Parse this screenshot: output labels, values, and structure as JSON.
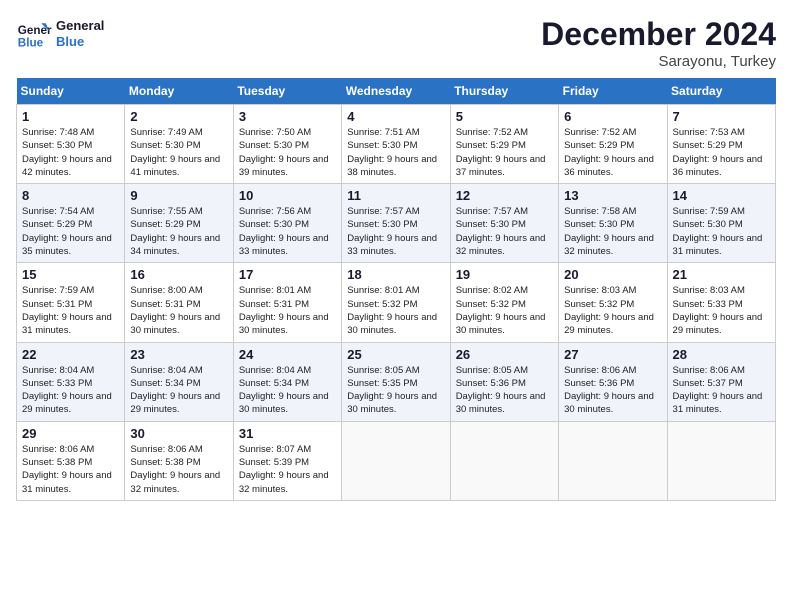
{
  "logo": {
    "line1": "General",
    "line2": "Blue"
  },
  "header": {
    "month": "December 2024",
    "location": "Sarayonu, Turkey"
  },
  "weekdays": [
    "Sunday",
    "Monday",
    "Tuesday",
    "Wednesday",
    "Thursday",
    "Friday",
    "Saturday"
  ],
  "weeks": [
    [
      {
        "day": "1",
        "sunrise": "Sunrise: 7:48 AM",
        "sunset": "Sunset: 5:30 PM",
        "daylight": "Daylight: 9 hours and 42 minutes."
      },
      {
        "day": "2",
        "sunrise": "Sunrise: 7:49 AM",
        "sunset": "Sunset: 5:30 PM",
        "daylight": "Daylight: 9 hours and 41 minutes."
      },
      {
        "day": "3",
        "sunrise": "Sunrise: 7:50 AM",
        "sunset": "Sunset: 5:30 PM",
        "daylight": "Daylight: 9 hours and 39 minutes."
      },
      {
        "day": "4",
        "sunrise": "Sunrise: 7:51 AM",
        "sunset": "Sunset: 5:30 PM",
        "daylight": "Daylight: 9 hours and 38 minutes."
      },
      {
        "day": "5",
        "sunrise": "Sunrise: 7:52 AM",
        "sunset": "Sunset: 5:29 PM",
        "daylight": "Daylight: 9 hours and 37 minutes."
      },
      {
        "day": "6",
        "sunrise": "Sunrise: 7:52 AM",
        "sunset": "Sunset: 5:29 PM",
        "daylight": "Daylight: 9 hours and 36 minutes."
      },
      {
        "day": "7",
        "sunrise": "Sunrise: 7:53 AM",
        "sunset": "Sunset: 5:29 PM",
        "daylight": "Daylight: 9 hours and 36 minutes."
      }
    ],
    [
      {
        "day": "8",
        "sunrise": "Sunrise: 7:54 AM",
        "sunset": "Sunset: 5:29 PM",
        "daylight": "Daylight: 9 hours and 35 minutes."
      },
      {
        "day": "9",
        "sunrise": "Sunrise: 7:55 AM",
        "sunset": "Sunset: 5:29 PM",
        "daylight": "Daylight: 9 hours and 34 minutes."
      },
      {
        "day": "10",
        "sunrise": "Sunrise: 7:56 AM",
        "sunset": "Sunset: 5:30 PM",
        "daylight": "Daylight: 9 hours and 33 minutes."
      },
      {
        "day": "11",
        "sunrise": "Sunrise: 7:57 AM",
        "sunset": "Sunset: 5:30 PM",
        "daylight": "Daylight: 9 hours and 33 minutes."
      },
      {
        "day": "12",
        "sunrise": "Sunrise: 7:57 AM",
        "sunset": "Sunset: 5:30 PM",
        "daylight": "Daylight: 9 hours and 32 minutes."
      },
      {
        "day": "13",
        "sunrise": "Sunrise: 7:58 AM",
        "sunset": "Sunset: 5:30 PM",
        "daylight": "Daylight: 9 hours and 32 minutes."
      },
      {
        "day": "14",
        "sunrise": "Sunrise: 7:59 AM",
        "sunset": "Sunset: 5:30 PM",
        "daylight": "Daylight: 9 hours and 31 minutes."
      }
    ],
    [
      {
        "day": "15",
        "sunrise": "Sunrise: 7:59 AM",
        "sunset": "Sunset: 5:31 PM",
        "daylight": "Daylight: 9 hours and 31 minutes."
      },
      {
        "day": "16",
        "sunrise": "Sunrise: 8:00 AM",
        "sunset": "Sunset: 5:31 PM",
        "daylight": "Daylight: 9 hours and 30 minutes."
      },
      {
        "day": "17",
        "sunrise": "Sunrise: 8:01 AM",
        "sunset": "Sunset: 5:31 PM",
        "daylight": "Daylight: 9 hours and 30 minutes."
      },
      {
        "day": "18",
        "sunrise": "Sunrise: 8:01 AM",
        "sunset": "Sunset: 5:32 PM",
        "daylight": "Daylight: 9 hours and 30 minutes."
      },
      {
        "day": "19",
        "sunrise": "Sunrise: 8:02 AM",
        "sunset": "Sunset: 5:32 PM",
        "daylight": "Daylight: 9 hours and 30 minutes."
      },
      {
        "day": "20",
        "sunrise": "Sunrise: 8:03 AM",
        "sunset": "Sunset: 5:32 PM",
        "daylight": "Daylight: 9 hours and 29 minutes."
      },
      {
        "day": "21",
        "sunrise": "Sunrise: 8:03 AM",
        "sunset": "Sunset: 5:33 PM",
        "daylight": "Daylight: 9 hours and 29 minutes."
      }
    ],
    [
      {
        "day": "22",
        "sunrise": "Sunrise: 8:04 AM",
        "sunset": "Sunset: 5:33 PM",
        "daylight": "Daylight: 9 hours and 29 minutes."
      },
      {
        "day": "23",
        "sunrise": "Sunrise: 8:04 AM",
        "sunset": "Sunset: 5:34 PM",
        "daylight": "Daylight: 9 hours and 29 minutes."
      },
      {
        "day": "24",
        "sunrise": "Sunrise: 8:04 AM",
        "sunset": "Sunset: 5:34 PM",
        "daylight": "Daylight: 9 hours and 30 minutes."
      },
      {
        "day": "25",
        "sunrise": "Sunrise: 8:05 AM",
        "sunset": "Sunset: 5:35 PM",
        "daylight": "Daylight: 9 hours and 30 minutes."
      },
      {
        "day": "26",
        "sunrise": "Sunrise: 8:05 AM",
        "sunset": "Sunset: 5:36 PM",
        "daylight": "Daylight: 9 hours and 30 minutes."
      },
      {
        "day": "27",
        "sunrise": "Sunrise: 8:06 AM",
        "sunset": "Sunset: 5:36 PM",
        "daylight": "Daylight: 9 hours and 30 minutes."
      },
      {
        "day": "28",
        "sunrise": "Sunrise: 8:06 AM",
        "sunset": "Sunset: 5:37 PM",
        "daylight": "Daylight: 9 hours and 31 minutes."
      }
    ],
    [
      {
        "day": "29",
        "sunrise": "Sunrise: 8:06 AM",
        "sunset": "Sunset: 5:38 PM",
        "daylight": "Daylight: 9 hours and 31 minutes."
      },
      {
        "day": "30",
        "sunrise": "Sunrise: 8:06 AM",
        "sunset": "Sunset: 5:38 PM",
        "daylight": "Daylight: 9 hours and 32 minutes."
      },
      {
        "day": "31",
        "sunrise": "Sunrise: 8:07 AM",
        "sunset": "Sunset: 5:39 PM",
        "daylight": "Daylight: 9 hours and 32 minutes."
      },
      null,
      null,
      null,
      null
    ]
  ]
}
